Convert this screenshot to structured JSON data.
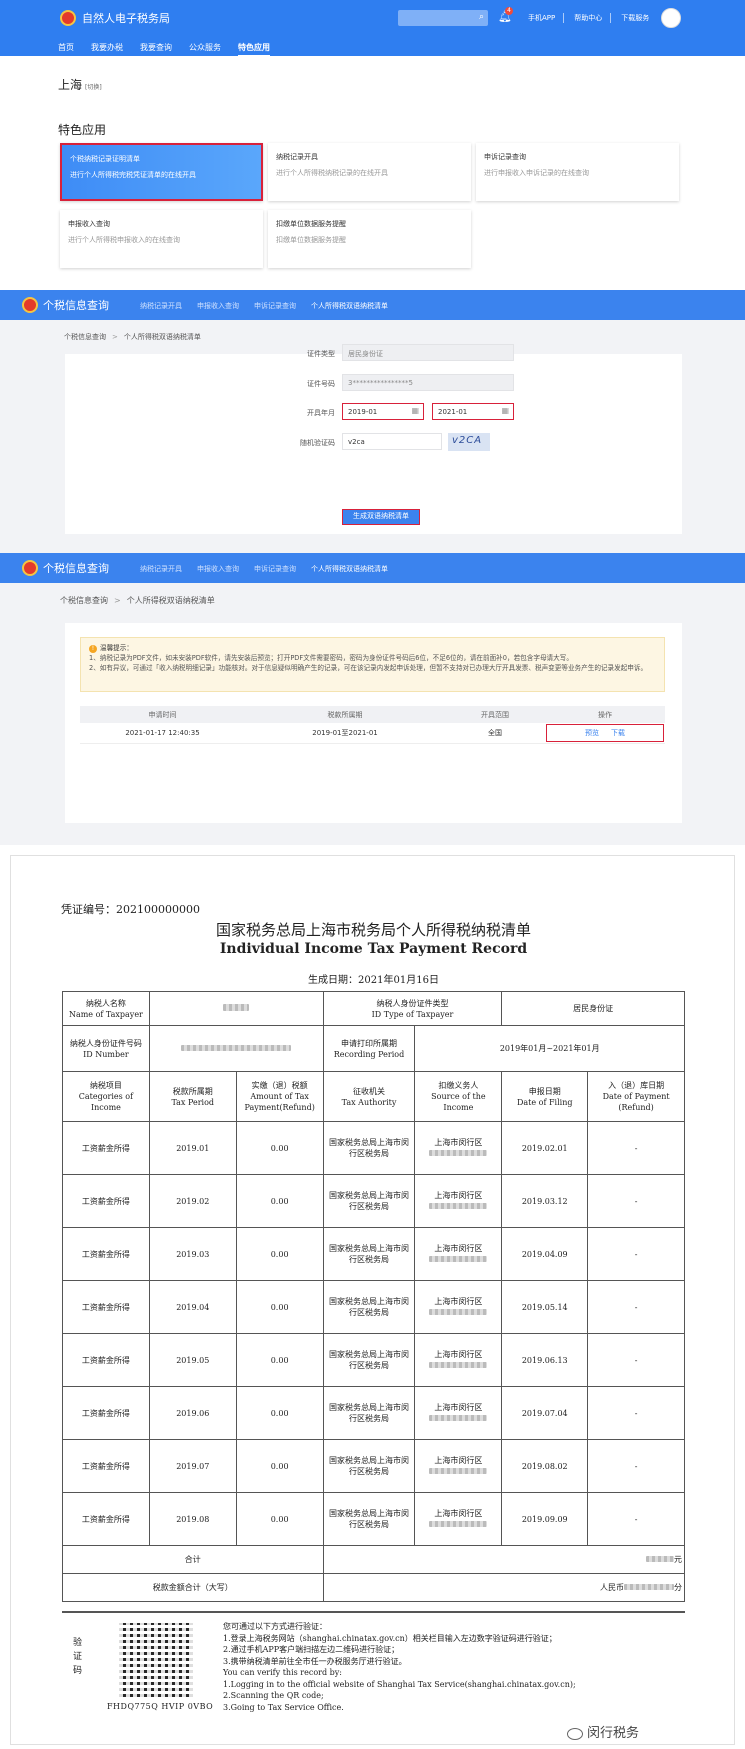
{
  "p1": {
    "site_title": "自然人电子税务局",
    "notification_count": "4",
    "top_links": [
      "手机APP",
      "帮助中心",
      "下载服务"
    ],
    "nav": [
      "首页",
      "我要办税",
      "我要查询",
      "公众服务",
      "特色应用"
    ],
    "city": "上海",
    "city_switch": "[切换]",
    "section_title": "特色应用",
    "cards": [
      {
        "title": "个税纳税记录证明清单",
        "desc": "进行个人所得税完税凭证清单的在线开具"
      },
      {
        "title": "纳税记录开具",
        "desc": "进行个人所得税纳税记录的在线开具"
      },
      {
        "title": "申诉记录查询",
        "desc": "进行申报收入申诉记录的在线查询"
      },
      {
        "title": "申报收入查询",
        "desc": "进行个人所得税申报收入的在线查询"
      },
      {
        "title": "扣缴单位数据服务提醒",
        "desc": "扣缴单位数据服务提醒"
      }
    ]
  },
  "p2": {
    "app_title": "个税信息查询",
    "nav": [
      "纳税记录开具",
      "申报收入查询",
      "申诉记录查询",
      "个人所得税双语纳税清单"
    ],
    "breadcrumb": [
      "个税信息查询",
      "个人所得税双语纳税清单"
    ],
    "labels": {
      "id_type": "证件类型",
      "id_number": "证件号码",
      "period": "开具年月",
      "captcha": "随机验证码"
    },
    "values": {
      "id_type": "居民身份证",
      "id_number": "3****************5",
      "start": "2019-01",
      "end": "2021-01",
      "captcha_input": "v2ca",
      "captcha_image": "v2CA"
    },
    "submit": "生成双语纳税清单"
  },
  "p3": {
    "app_title": "个税信息查询",
    "nav": [
      "纳税记录开具",
      "申报收入查询",
      "申诉记录查询",
      "个人所得税双语纳税清单"
    ],
    "breadcrumb": [
      "个税信息查询",
      "个人所得税双语纳税清单"
    ],
    "tips_title": "温馨提示：",
    "tips": [
      "1、纳税记录为PDF文件，如未安装PDF软件，请先安装后预览；打开PDF文件需要密码，密码为身份证件号码后6位，不足6位的，请在前面补0，若包含字母请大写。",
      "2、如有异议，可通过「收入纳税明细记录」功能核对。对于信息疑似明确产生的记录，可在该记录内发起申诉处理，但暂不支持对已办理大厅开具发票、税声变更等业务产生的记录发起申诉。"
    ],
    "headers": [
      "申请时间",
      "税款所属期",
      "开具范围",
      "操作"
    ],
    "row": {
      "time": "2021-01-17 12:40:35",
      "period": "2019-01至2021-01",
      "range": "全国",
      "preview": "预览",
      "download": "下载"
    }
  },
  "doc": {
    "voucher": "凭证编号：202100000000",
    "title_cn": "国家税务总局上海市税务局个人所得税纳税清单",
    "title_en": "Individual Income Tax Payment Record",
    "gen_date": "生成日期：2021年01月16日",
    "h": {
      "name_cn": "纳税人名称",
      "name_en": "Name of Taxpayer",
      "idtype_cn": "纳税人身份证件类型",
      "idtype_en": "ID Type of Taxpayer",
      "idtype_val": "居民身份证",
      "idnum_cn": "纳税人身份证件号码",
      "idnum_en": "ID Number",
      "period_cn": "申请打印所属期",
      "period_en": "Recording Period",
      "period_val": "2019年01月~2021年01月",
      "c1_cn": "纳税项目",
      "c1_en": "Categories of Income",
      "c2_cn": "税款所属期",
      "c2_en": "Tax Period",
      "c3_cn": "实缴（退）税额",
      "c3_en": "Amount of Tax Payment(Refund)",
      "c4_cn": "征收机关",
      "c4_en": "Tax Authority",
      "c5_cn": "扣缴义务人",
      "c5_en": "Source of the Income",
      "c6_cn": "申报日期",
      "c6_en": "Date of Filing",
      "c7_cn": "入（退）库日期",
      "c7_en": "Date of Payment (Refund)"
    },
    "rows": [
      {
        "cat": "工资薪金所得",
        "period": "2019.01",
        "amt": "0.00",
        "auth": "国家税务总局上海市闵行区税务局",
        "src": "上海市闵行区",
        "filed": "2019.02.01",
        "paid": "-"
      },
      {
        "cat": "工资薪金所得",
        "period": "2019.02",
        "amt": "0.00",
        "auth": "国家税务总局上海市闵行区税务局",
        "src": "上海市闵行区",
        "filed": "2019.03.12",
        "paid": "-"
      },
      {
        "cat": "工资薪金所得",
        "period": "2019.03",
        "amt": "0.00",
        "auth": "国家税务总局上海市闵行区税务局",
        "src": "上海市闵行区",
        "filed": "2019.04.09",
        "paid": "-"
      },
      {
        "cat": "工资薪金所得",
        "period": "2019.04",
        "amt": "0.00",
        "auth": "国家税务总局上海市闵行区税务局",
        "src": "上海市闵行区",
        "filed": "2019.05.14",
        "paid": "-"
      },
      {
        "cat": "工资薪金所得",
        "period": "2019.05",
        "amt": "0.00",
        "auth": "国家税务总局上海市闵行区税务局",
        "src": "上海市闵行区",
        "filed": "2019.06.13",
        "paid": "-"
      },
      {
        "cat": "工资薪金所得",
        "period": "2019.06",
        "amt": "0.00",
        "auth": "国家税务总局上海市闵行区税务局",
        "src": "上海市闵行区",
        "filed": "2019.07.04",
        "paid": "-"
      },
      {
        "cat": "工资薪金所得",
        "period": "2019.07",
        "amt": "0.00",
        "auth": "国家税务总局上海市闵行区税务局",
        "src": "上海市闵行区",
        "filed": "2019.08.02",
        "paid": "-"
      },
      {
        "cat": "工资薪金所得",
        "period": "2019.08",
        "amt": "0.00",
        "auth": "国家税务总局上海市闵行区税务局",
        "src": "上海市闵行区",
        "filed": "2019.09.09",
        "paid": "-"
      }
    ],
    "total_label": "合计",
    "total_suffix": "元",
    "total_cn_label": "税款金额合计（大写）",
    "total_cn_prefix": "人民币",
    "total_cn_suffix": "分",
    "verify_label": "验证码",
    "qr_code": "FHDQ775Q HVIP 0VBO",
    "verify_lines": [
      "您可通过以下方式进行验证：",
      "1.登录上海税务网站（shanghai.chinatax.gov.cn）相关栏目输入左边数字验证码进行验证；",
      "2.通过手机APP客户端扫描左边二维码进行验证；",
      "3.携带纳税清单前往全市任一办税服务厅进行验证。",
      "You can verify this record by:",
      "1.Logging in to the official website of Shanghai Tax Service(shanghai.chinatax.gov.cn);",
      "2.Scanning the QR code;",
      "3.Going to Tax Service Office."
    ],
    "watermark": "闵行税务"
  }
}
